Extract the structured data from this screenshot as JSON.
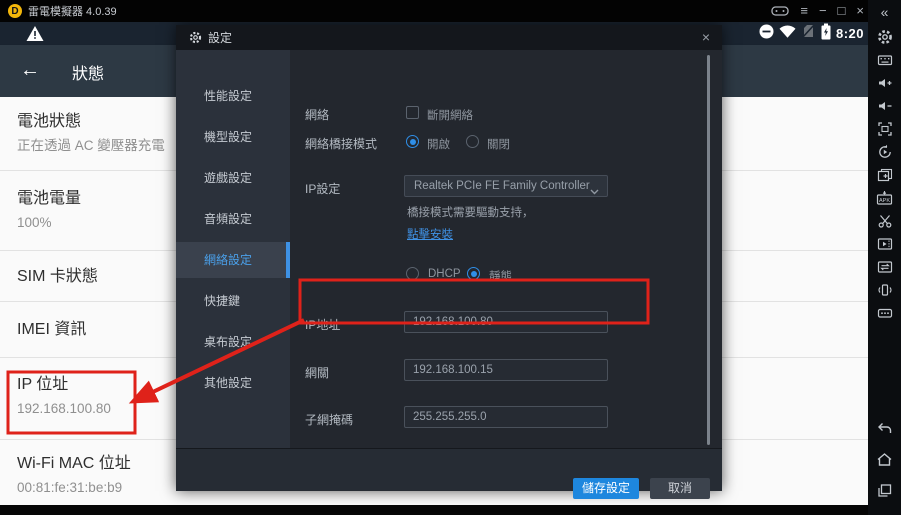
{
  "titlebar": {
    "title": "雷電模擬器 4.0.39",
    "minimize_label": "−",
    "maximize_label": "□",
    "close_label": "×",
    "menu_label": "≡"
  },
  "status_bar": {
    "time": "8:20"
  },
  "status_page": {
    "header": "狀態",
    "back_arrow": "←",
    "rows": [
      {
        "title": "電池狀態",
        "value": "正在透過 AC 變壓器充電"
      },
      {
        "title": "電池電量",
        "value": "100%"
      },
      {
        "title": "SIM 卡狀態",
        "value": ""
      },
      {
        "title": "IMEI 資訊",
        "value": ""
      },
      {
        "title": "IP 位址",
        "value": "192.168.100.80"
      },
      {
        "title": "Wi-Fi MAC 位址",
        "value": "00:81:fe:31:be:b9"
      }
    ]
  },
  "dialog": {
    "title": "設定",
    "close_label": "×",
    "nav": [
      {
        "label": "性能設定"
      },
      {
        "label": "機型設定"
      },
      {
        "label": "遊戲設定"
      },
      {
        "label": "音頻設定"
      },
      {
        "label": "網絡設定",
        "selected": true
      },
      {
        "label": "快捷鍵"
      },
      {
        "label": "桌布設定"
      },
      {
        "label": "其他設定"
      }
    ],
    "network": {
      "label": "網絡",
      "disconnect_label": "斷開網絡",
      "bridge_label": "網絡橋接模式",
      "bridge_on": "開啟",
      "bridge_off": "關閉",
      "ip_setting_label": "IP設定",
      "adapter": "Realtek PCIe FE Family Controller",
      "driver_note": "橋接模式需要驅動支持，",
      "install_link": "點擊安裝",
      "dhcp_label": "DHCP",
      "static_label": "靜態",
      "ip_label": "IP地址",
      "ip_value": "192.168.100.80",
      "gateway_label": "網關",
      "gateway_value": "192.168.100.15",
      "mask_label": "子網掩碼",
      "mask_value": "255.255.255.0"
    },
    "save_label": "儲存設定",
    "cancel_label": "取消"
  },
  "right_sidebar": {
    "icons": [
      "collapse",
      "settings",
      "keyboard",
      "volume-up",
      "volume-down",
      "fullscreen",
      "restart",
      "screenshot",
      "apk-install",
      "scissors",
      "screen-record",
      "sync",
      "shake",
      "more",
      "back",
      "home",
      "recent-apps"
    ]
  },
  "colors": {
    "accent": "#2f8fe8",
    "annotation_red": "#df221a",
    "save_button": "#1e87de",
    "logo_yellow": "#f3b70b"
  }
}
